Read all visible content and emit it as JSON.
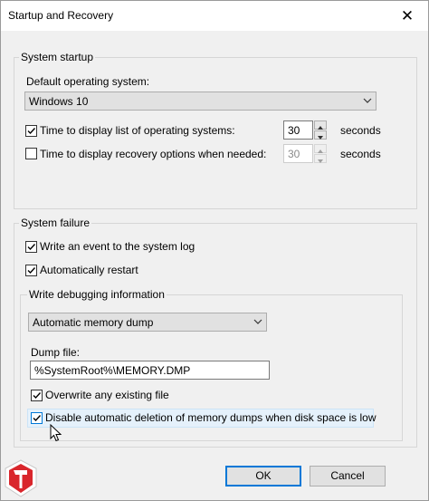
{
  "window": {
    "title": "Startup and Recovery",
    "close_glyph": "✕"
  },
  "system_startup": {
    "legend": "System startup",
    "default_os_label": "Default operating system:",
    "default_os_value": "Windows 10",
    "time_os_list_label": "Time to display list of operating systems:",
    "time_os_list_checked": true,
    "time_os_list_value": "30",
    "time_recovery_label": "Time to display recovery options when needed:",
    "time_recovery_checked": false,
    "time_recovery_value": "30",
    "seconds_label": "seconds"
  },
  "system_failure": {
    "legend": "System failure",
    "write_event_label": "Write an event to the system log",
    "write_event_checked": true,
    "auto_restart_label": "Automatically restart",
    "auto_restart_checked": true,
    "debug": {
      "legend": "Write debugging information",
      "dump_type_value": "Automatic memory dump",
      "dump_file_label": "Dump file:",
      "dump_file_value": "%SystemRoot%\\MEMORY.DMP",
      "overwrite_label": "Overwrite any existing file",
      "overwrite_checked": true,
      "disable_delete_label": "Disable automatic deletion of memory dumps when disk space is low",
      "disable_delete_checked": true
    }
  },
  "buttons": {
    "ok": "OK",
    "cancel": "Cancel"
  },
  "icons": [
    "close-icon",
    "chevron-down-icon",
    "checkmark-icon",
    "spin-up-icon",
    "spin-down-icon",
    "mouse-cursor-icon",
    "brand-logo-icon"
  ],
  "colors": {
    "focus_border": "#0078d7",
    "hover_highlight": "#e5f1fb",
    "logo_red": "#d9262c"
  }
}
